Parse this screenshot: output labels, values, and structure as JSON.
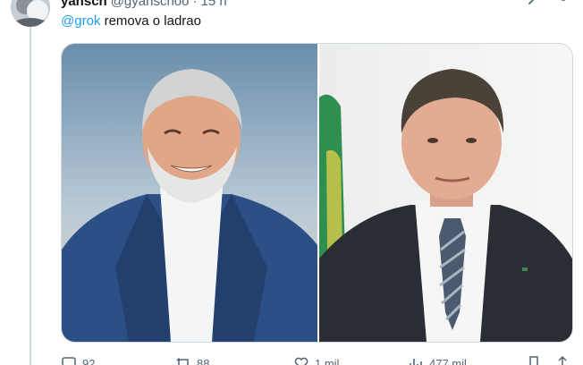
{
  "tweet": {
    "display_name": "yansch",
    "handle": "@gyanschoo",
    "separator": "·",
    "time": "15 h",
    "mention": "@grok",
    "text": "remova o ladrao"
  },
  "actions": {
    "replies": "92",
    "reposts": "88",
    "likes": "1 mil",
    "views": "477 mil"
  },
  "colors": {
    "link": "#1d9bf0",
    "muted": "#536471",
    "border": "#cfd9de"
  },
  "icons": {
    "more": "more-icon",
    "grok": "grok-icon",
    "reply": "reply-icon",
    "repost": "repost-icon",
    "like": "heart-icon",
    "views": "views-icon",
    "bookmark": "bookmark-icon",
    "share": "share-icon"
  }
}
